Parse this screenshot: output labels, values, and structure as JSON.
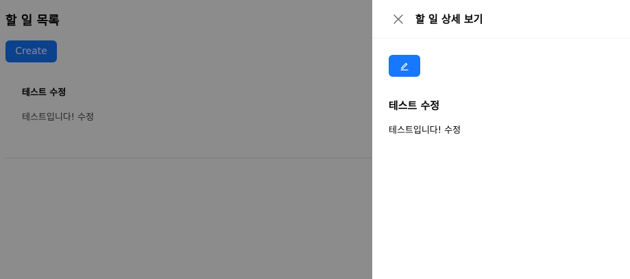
{
  "list_page": {
    "title": "할 일 목록",
    "create_label": "Create",
    "items": [
      {
        "title": "테스트 수정",
        "description": "테스트입니다! 수정"
      }
    ]
  },
  "drawer": {
    "title": "할 일 상세 보기",
    "close_icon": "close-icon",
    "edit_icon": "edit-icon",
    "detail": {
      "title": "테스트 수정",
      "description": "테스트입니다! 수정"
    }
  },
  "colors": {
    "accent": "#1677ff",
    "mask": "rgba(0,0,0,0.45)"
  }
}
